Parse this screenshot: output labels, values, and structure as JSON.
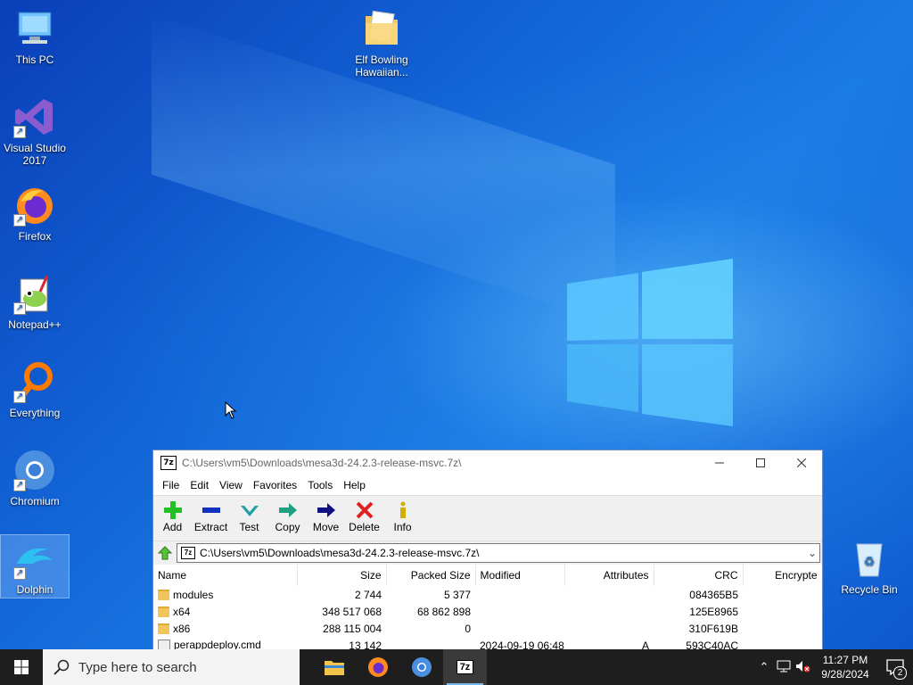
{
  "desktop": {
    "icons": [
      {
        "label": "This PC"
      },
      {
        "label": "Visual Studio 2017"
      },
      {
        "label": "Firefox"
      },
      {
        "label": "Notepad++"
      },
      {
        "label": "Everything"
      },
      {
        "label": "Chromium"
      },
      {
        "label": "Dolphin"
      },
      {
        "label": "Elf Bowling Hawaiian..."
      },
      {
        "label": "Recycle Bin"
      }
    ]
  },
  "window": {
    "title": "C:\\Users\\vm5\\Downloads\\mesa3d-24.2.3-release-msvc.7z\\",
    "app_icon": "7z",
    "menu": [
      "File",
      "Edit",
      "View",
      "Favorites",
      "Tools",
      "Help"
    ],
    "toolbar": [
      {
        "label": "Add",
        "icon": "plus-icon",
        "color": "#22c022"
      },
      {
        "label": "Extract",
        "icon": "minus-icon",
        "color": "#1030c0"
      },
      {
        "label": "Test",
        "icon": "checkmark-icon",
        "color": "#20a0a0"
      },
      {
        "label": "Copy",
        "icon": "arrow-right-icon",
        "color": "#20a080"
      },
      {
        "label": "Move",
        "icon": "arrow-right-icon",
        "color": "#101080"
      },
      {
        "label": "Delete",
        "icon": "x-icon",
        "color": "#e02020"
      },
      {
        "label": "Info",
        "icon": "info-icon",
        "color": "#d0b000"
      }
    ],
    "address": "C:\\Users\\vm5\\Downloads\\mesa3d-24.2.3-release-msvc.7z\\",
    "columns": [
      "Name",
      "Size",
      "Packed Size",
      "Modified",
      "Attributes",
      "CRC",
      "Encrypte"
    ],
    "rows": [
      {
        "type": "folder",
        "name": "modules",
        "size": "2 744",
        "packed": "5 377",
        "modified": "",
        "attr": "",
        "crc": "084365B5"
      },
      {
        "type": "folder",
        "name": "x64",
        "size": "348 517 068",
        "packed": "68 862 898",
        "modified": "",
        "attr": "",
        "crc": "125E8965"
      },
      {
        "type": "folder",
        "name": "x86",
        "size": "288 115 004",
        "packed": "0",
        "modified": "",
        "attr": "",
        "crc": "310F619B"
      },
      {
        "type": "file",
        "name": "perappdeploy.cmd",
        "size": "13 142",
        "packed": "",
        "modified": "2024-09-19 06:48",
        "attr": "A",
        "crc": "593C40AC"
      }
    ]
  },
  "taskbar": {
    "search_placeholder": "Type here to search",
    "apps": [
      "file-explorer",
      "firefox",
      "chromium",
      "7zip"
    ],
    "time": "11:27 PM",
    "date": "9/28/2024",
    "notification_count": "2"
  },
  "colors": {
    "taskbar": "#1e1e1e",
    "desktop_blue": "#1263d6"
  }
}
